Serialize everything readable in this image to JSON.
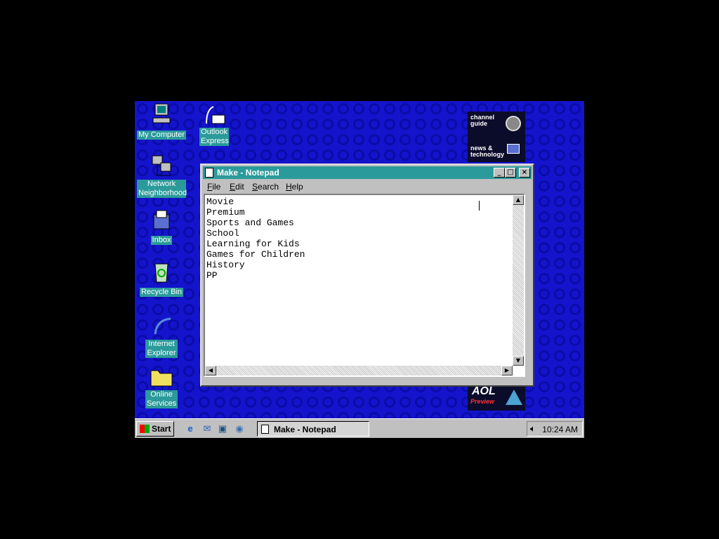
{
  "desktop": {
    "icons": [
      {
        "label": "My Computer"
      },
      {
        "label": "Network Neighborhood"
      },
      {
        "label": "Inbox"
      },
      {
        "label": "Recycle Bin"
      },
      {
        "label": "Internet Explorer"
      },
      {
        "label": "Online Services"
      },
      {
        "label": "Outlook Express"
      }
    ],
    "channel_bar": {
      "guide": "channel guide",
      "news": "news & technology"
    },
    "aol": {
      "name": "AOL",
      "sub": "Preview"
    }
  },
  "notepad": {
    "title": "Make - Notepad",
    "buttons": {
      "minimize": "_",
      "maximize": "□",
      "close": "×"
    },
    "menu": [
      "File",
      "Edit",
      "Search",
      "Help"
    ],
    "lines": [
      "Movie",
      "Premium",
      "Sports and Games",
      "School",
      "Learning for Kids",
      "Games for Children",
      "History",
      "PP"
    ]
  },
  "taskbar": {
    "start": "Start",
    "quick_launch": [
      "internet-explorer-icon",
      "outlook-express-icon",
      "show-desktop-icon",
      "channels-icon"
    ],
    "task": "Make - Notepad",
    "clock": "10:24 AM"
  },
  "colors": {
    "desktop": "#1414cc",
    "titlebar": "#2b9a9a",
    "face": "#c0c0c0"
  }
}
